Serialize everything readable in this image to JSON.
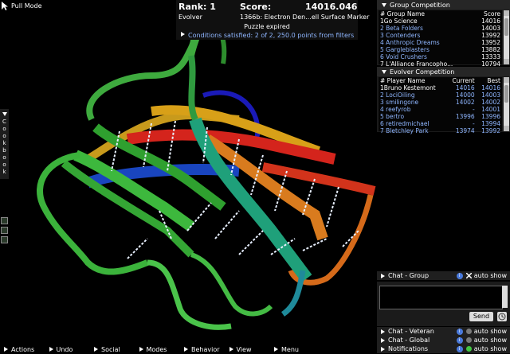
{
  "pull_mode_label": "Pull Mode",
  "score_panel": {
    "rank": "Rank: 1",
    "score_label": "Score:",
    "score": "14016.046",
    "player": "Evolver",
    "puzzle": "1366b: Electron Den...ell Surface Marker",
    "status": "Puzzle expired",
    "conditions": "Conditions satisfied: 2 of 2, 250.0 points from filters"
  },
  "cookbook_label": "Cookbook",
  "group_competition": {
    "title": "Group Competition",
    "columns": [
      "# Group Name",
      "Score"
    ],
    "rows": [
      {
        "name": "1Go Science",
        "score": "14016",
        "link": false
      },
      {
        "name": "2 Beta Folders",
        "score": "14003",
        "link": true
      },
      {
        "name": "3 Contenders",
        "score": "13992",
        "link": true
      },
      {
        "name": "4 Anthropic Dreams",
        "score": "13952",
        "link": true
      },
      {
        "name": "5 Gargleblasters",
        "score": "13882",
        "link": true
      },
      {
        "name": "6 Void Crushers",
        "score": "13333",
        "link": true
      },
      {
        "name": "7 L'Alliance Francopho...",
        "score": "10794",
        "link": false
      }
    ]
  },
  "evolver_competition": {
    "title": "Evolver Competition",
    "columns": [
      "# Player Name",
      "Current",
      "Best"
    ],
    "rows": [
      {
        "name": "1Bruno Kestemont",
        "current": "14016",
        "best": "14016",
        "link": false
      },
      {
        "name": "2 LociOiling",
        "current": "14000",
        "best": "14003",
        "link": true
      },
      {
        "name": "3 smilingone",
        "current": "14002",
        "best": "14002",
        "link": true
      },
      {
        "name": "4 reefyrob",
        "current": "-",
        "best": "14001",
        "link": true
      },
      {
        "name": "5 bertro",
        "current": "13996",
        "best": "13996",
        "link": true
      },
      {
        "name": "6 retiredmichael",
        "current": "-",
        "best": "13994",
        "link": true
      },
      {
        "name": "7 Bletchley Park",
        "current": "13974",
        "best": "13992",
        "link": true
      }
    ]
  },
  "chat": {
    "group_label": "Chat - Group",
    "veteran_label": "Chat - Veteran",
    "global_label": "Chat - Global",
    "notifications_label": "Notifications",
    "auto_show": "auto show",
    "send_label": "Send"
  },
  "menu": [
    "Actions",
    "Undo",
    "Social",
    "Modes",
    "Behavior",
    "View",
    "Menu"
  ],
  "colors": {
    "link": "#8fb6ff",
    "panel": "#1b1b1b",
    "notification_dot": "#42c742"
  }
}
